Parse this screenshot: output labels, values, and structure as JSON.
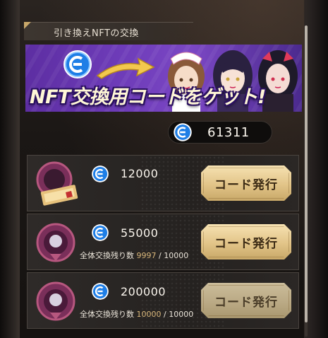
{
  "header": {
    "title": "引き換えNFTの交換"
  },
  "banner": {
    "headline": "NFT交換用コードをゲット!"
  },
  "balance": {
    "value": "61311",
    "icon": "coin-icon"
  },
  "offers": [
    {
      "price": "12000",
      "remaining_label": "",
      "remaining_current": "",
      "remaining_sep": "",
      "remaining_total": "",
      "button": "コード発行",
      "available": true
    },
    {
      "price": "55000",
      "remaining_label": "全体交換残り数",
      "remaining_current": "9997",
      "remaining_sep": "/",
      "remaining_total": "10000",
      "button": "コード発行",
      "available": true
    },
    {
      "price": "200000",
      "remaining_label": "全体交換残り数",
      "remaining_current": "10000",
      "remaining_sep": "/",
      "remaining_total": "10000",
      "button": "コード発行",
      "available": true
    }
  ],
  "colors": {
    "coin": "#1e7ee6",
    "accent": "#d9b77b",
    "banner": "#6e3cb9",
    "button": "#e2c488"
  }
}
